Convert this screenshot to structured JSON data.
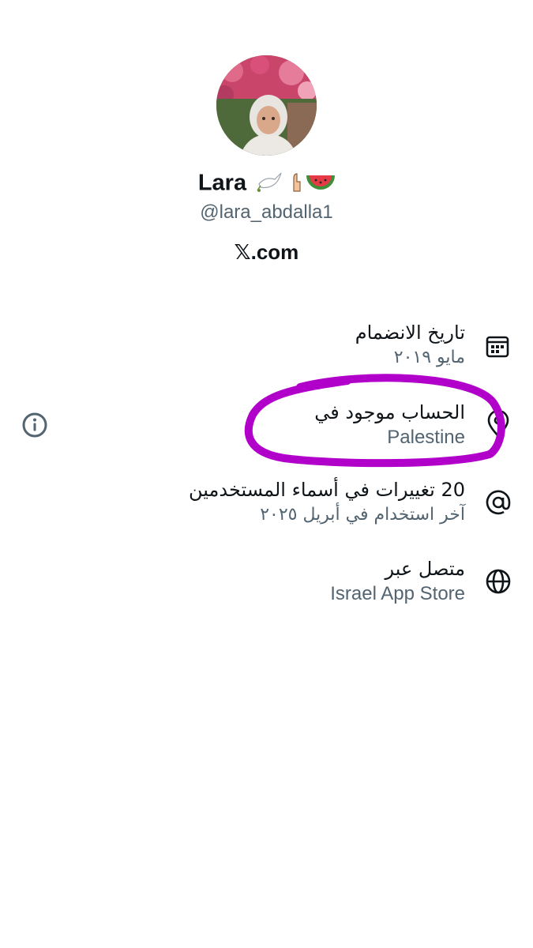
{
  "profile": {
    "display_name": "Lara",
    "emoji_decor": "🕊️ ☝ 🍉",
    "handle": "@lara_abdalla1",
    "site": "𝕏.com"
  },
  "details": {
    "join": {
      "title": "تاريخ الانضمام",
      "value": "مايو ٢٠١٩",
      "icon": "calendar-icon"
    },
    "location": {
      "title": "الحساب موجود في",
      "value": "Palestine",
      "icon": "location-pin-icon"
    },
    "username_changes": {
      "title": "20 تغييرات في أسماء المستخدمين",
      "value": "آخر استخدام في أبريل ٢٠٢٥",
      "icon": "at-sign-icon"
    },
    "connected_via": {
      "title": "متصل عبر",
      "value": "Israel App Store",
      "icon": "globe-icon"
    }
  },
  "colors": {
    "text_primary": "#0f1419",
    "text_secondary": "#536471",
    "highlight_marker": "#b100c9"
  }
}
